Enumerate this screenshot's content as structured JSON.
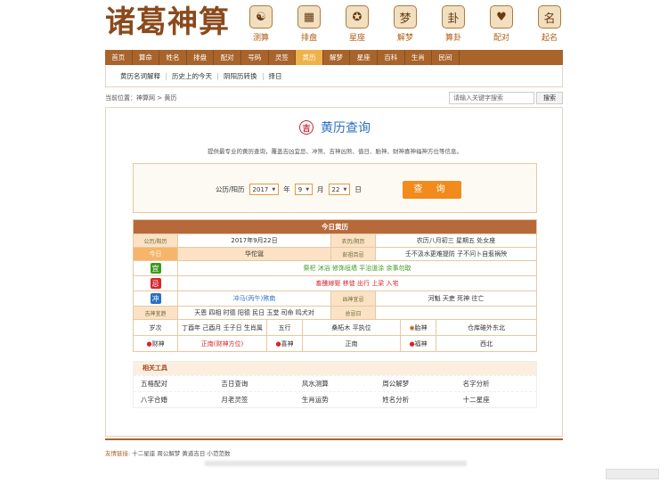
{
  "brand": {
    "logo": "诸葛神算"
  },
  "header_icons": [
    {
      "glyph": "☯",
      "label": "测算",
      "icon": "yinyang-icon"
    },
    {
      "glyph": "▦",
      "label": "排盘",
      "icon": "compass-icon"
    },
    {
      "glyph": "✪",
      "label": "星座",
      "icon": "zodiac-icon"
    },
    {
      "glyph": "梦",
      "label": "解梦",
      "icon": "dream-icon"
    },
    {
      "glyph": "卦",
      "label": "算卦",
      "icon": "hexagram-icon"
    },
    {
      "glyph": "♥",
      "label": "配对",
      "icon": "heart-icon"
    },
    {
      "glyph": "名",
      "label": "起名",
      "icon": "name-icon"
    }
  ],
  "nav": [
    "首页",
    "算命",
    "姓名",
    "排盘",
    "配对",
    "号码",
    "灵签",
    "黄历",
    "解梦",
    "星座",
    "百科",
    "生肖",
    "民间"
  ],
  "nav_active_index": 7,
  "subnav": [
    "黄历名词解释",
    "历史上的今天",
    "阴阳历转换",
    "择日"
  ],
  "breadcrumb": "当前位置：神算网 > 黄历",
  "search": {
    "placeholder": "请输入关键字搜索",
    "button": "搜索"
  },
  "title": "黄历查询",
  "title_icon": "吉",
  "intro": "提供最专业的黄历查询，覆盖吉凶宜忌、冲煞、吉神凶煞、值日、胎神、财神喜神福神方位等信息。",
  "query": {
    "calendar_label": "公历/阳历",
    "year": "2017",
    "year_unit": "年",
    "month": "9",
    "month_unit": "月",
    "day": "22",
    "day_unit": "日",
    "button": "查 询"
  },
  "today": {
    "header": "今日黄历",
    "solar_label": "公历/阳历",
    "solar_value": "2017年9月22日",
    "lunar_label": "农历/阴历",
    "lunar_value": "农历八月初三 星期五 处女座",
    "today_label": "今日",
    "today_value": "华佗诞",
    "pengzu_label": "彭祖百忌",
    "pengzu_value": "壬不汲水更难提防 子不问卜自惹祸殃",
    "yi_badge": "宜",
    "yi_value": "祭祀 沐浴 修饰垣墙 平治道涂 余事勿取",
    "ji_badge": "忌",
    "ji_value": "嫁娶 移徙 出行 上梁 入宅",
    "ji_prefix": "畜醮 ",
    "chong_badge": "冲",
    "chong_value": "冲马(丙午)煞南",
    "xiongshen_label": "凶神宜忌",
    "xiongshen_value": "河魁 天吏 死神 往亡",
    "jishen_label": "吉神宜趋",
    "jishen_value": "天恩 四相 时德 阳德 民日 玉堂 司命 鸣犬对",
    "zongsuan_label": "总忌日",
    "jiaci_label": "岁次",
    "jiaci_value": "丁酉年 己酉月 壬子日 生肖属",
    "wuxing_label": "五行",
    "wuxing_value": "桑柘木 平执位",
    "taishen_label": "胎神",
    "taishen_value": "仓库碓外东北",
    "caishen_label": "财神",
    "caishen_value": "正南(财神方位)",
    "xishen_label": "喜神",
    "xishen_value": "正南",
    "fushen_label": "福神",
    "fushen_value": "西北"
  },
  "tools": {
    "header": "相关工具",
    "rows": [
      [
        "五格配对",
        "吉日查询",
        "风水测算",
        "周公解梦",
        "名字分析"
      ],
      [
        "八字合婚",
        "月老灵签",
        "生肖运势",
        "姓名分析",
        "十二星座"
      ]
    ]
  },
  "friends": {
    "label": "友情链接:",
    "links": "十二星座 周公解梦 黄道吉日 小范范数"
  },
  "colors": {
    "brand": "#8a4a1c",
    "nav": "#a8642b",
    "active": "#efb24a",
    "button": "#f08b1c"
  }
}
